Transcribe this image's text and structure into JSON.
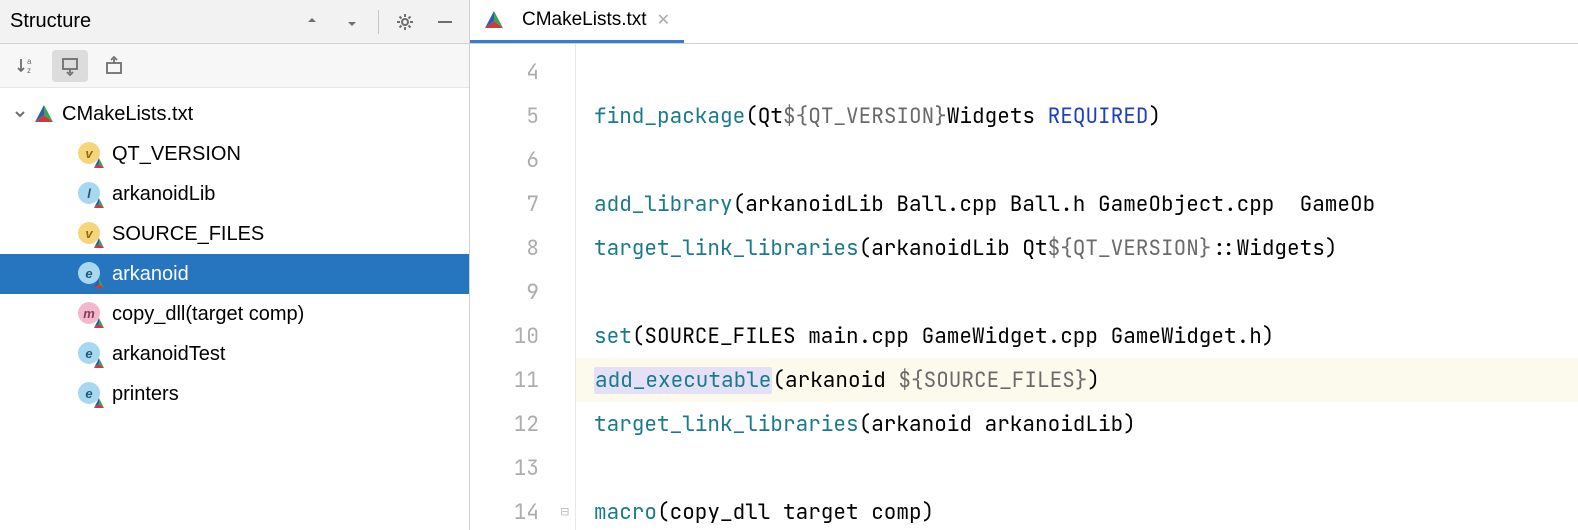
{
  "sidebar": {
    "title": "Structure",
    "root": {
      "label": "CMakeLists.txt",
      "expanded": true
    },
    "items": [
      {
        "label": "QT_VERSION",
        "badge": "v",
        "badgeClass": "circle-v"
      },
      {
        "label": "arkanoidLib",
        "badge": "l",
        "badgeClass": "circle-l"
      },
      {
        "label": "SOURCE_FILES",
        "badge": "v",
        "badgeClass": "circle-v"
      },
      {
        "label": "arkanoid",
        "badge": "e",
        "badgeClass": "circle-e",
        "selected": true
      },
      {
        "label": "copy_dll(target comp)",
        "badge": "m",
        "badgeClass": "circle-m"
      },
      {
        "label": "arkanoidTest",
        "badge": "e",
        "badgeClass": "circle-e"
      },
      {
        "label": "printers",
        "badge": "e",
        "badgeClass": "circle-e"
      }
    ]
  },
  "tab": {
    "label": "CMakeLists.txt"
  },
  "code": {
    "lines": [
      {
        "n": 4,
        "segments": []
      },
      {
        "n": 5,
        "segments": [
          {
            "t": "find_package",
            "c": "tok-fn"
          },
          {
            "t": "(Qt",
            "c": "tok-txt"
          },
          {
            "t": "${QT_VERSION}",
            "c": "tok-var"
          },
          {
            "t": "Widgets ",
            "c": "tok-txt"
          },
          {
            "t": "REQUIRED",
            "c": "tok-kw"
          },
          {
            "t": ")",
            "c": "tok-txt"
          }
        ]
      },
      {
        "n": 6,
        "segments": []
      },
      {
        "n": 7,
        "segments": [
          {
            "t": "add_library",
            "c": "tok-fn"
          },
          {
            "t": "(arkanoidLib Ball.cpp Ball.h GameObject.cpp  GameOb",
            "c": "tok-txt"
          }
        ]
      },
      {
        "n": 8,
        "segments": [
          {
            "t": "target_link_libraries",
            "c": "tok-fn"
          },
          {
            "t": "(arkanoidLib Qt",
            "c": "tok-txt"
          },
          {
            "t": "${QT_VERSION}",
            "c": "tok-var"
          },
          {
            "t": "::Widgets)",
            "c": "tok-txt"
          }
        ]
      },
      {
        "n": 9,
        "segments": []
      },
      {
        "n": 10,
        "segments": [
          {
            "t": "set",
            "c": "tok-fn"
          },
          {
            "t": "(SOURCE_FILES main.cpp GameWidget.cpp GameWidget.h)",
            "c": "tok-txt"
          }
        ]
      },
      {
        "n": 11,
        "hl": true,
        "segments": [
          {
            "t": "add_executable",
            "c": "tok-fn",
            "wrap": "exec-hl"
          },
          {
            "t": "(arkanoid ",
            "c": "tok-txt"
          },
          {
            "t": "${SOURCE_FILES}",
            "c": "tok-var"
          },
          {
            "t": ")",
            "c": "tok-txt"
          }
        ]
      },
      {
        "n": 12,
        "segments": [
          {
            "t": "target_link_libraries",
            "c": "tok-fn"
          },
          {
            "t": "(arkanoid arkanoidLib)",
            "c": "tok-txt"
          }
        ]
      },
      {
        "n": 13,
        "segments": []
      },
      {
        "n": 14,
        "fold": true,
        "segments": [
          {
            "t": "macro",
            "c": "tok-fn"
          },
          {
            "t": "(copy_dll target comp)",
            "c": "tok-txt"
          }
        ]
      }
    ]
  }
}
